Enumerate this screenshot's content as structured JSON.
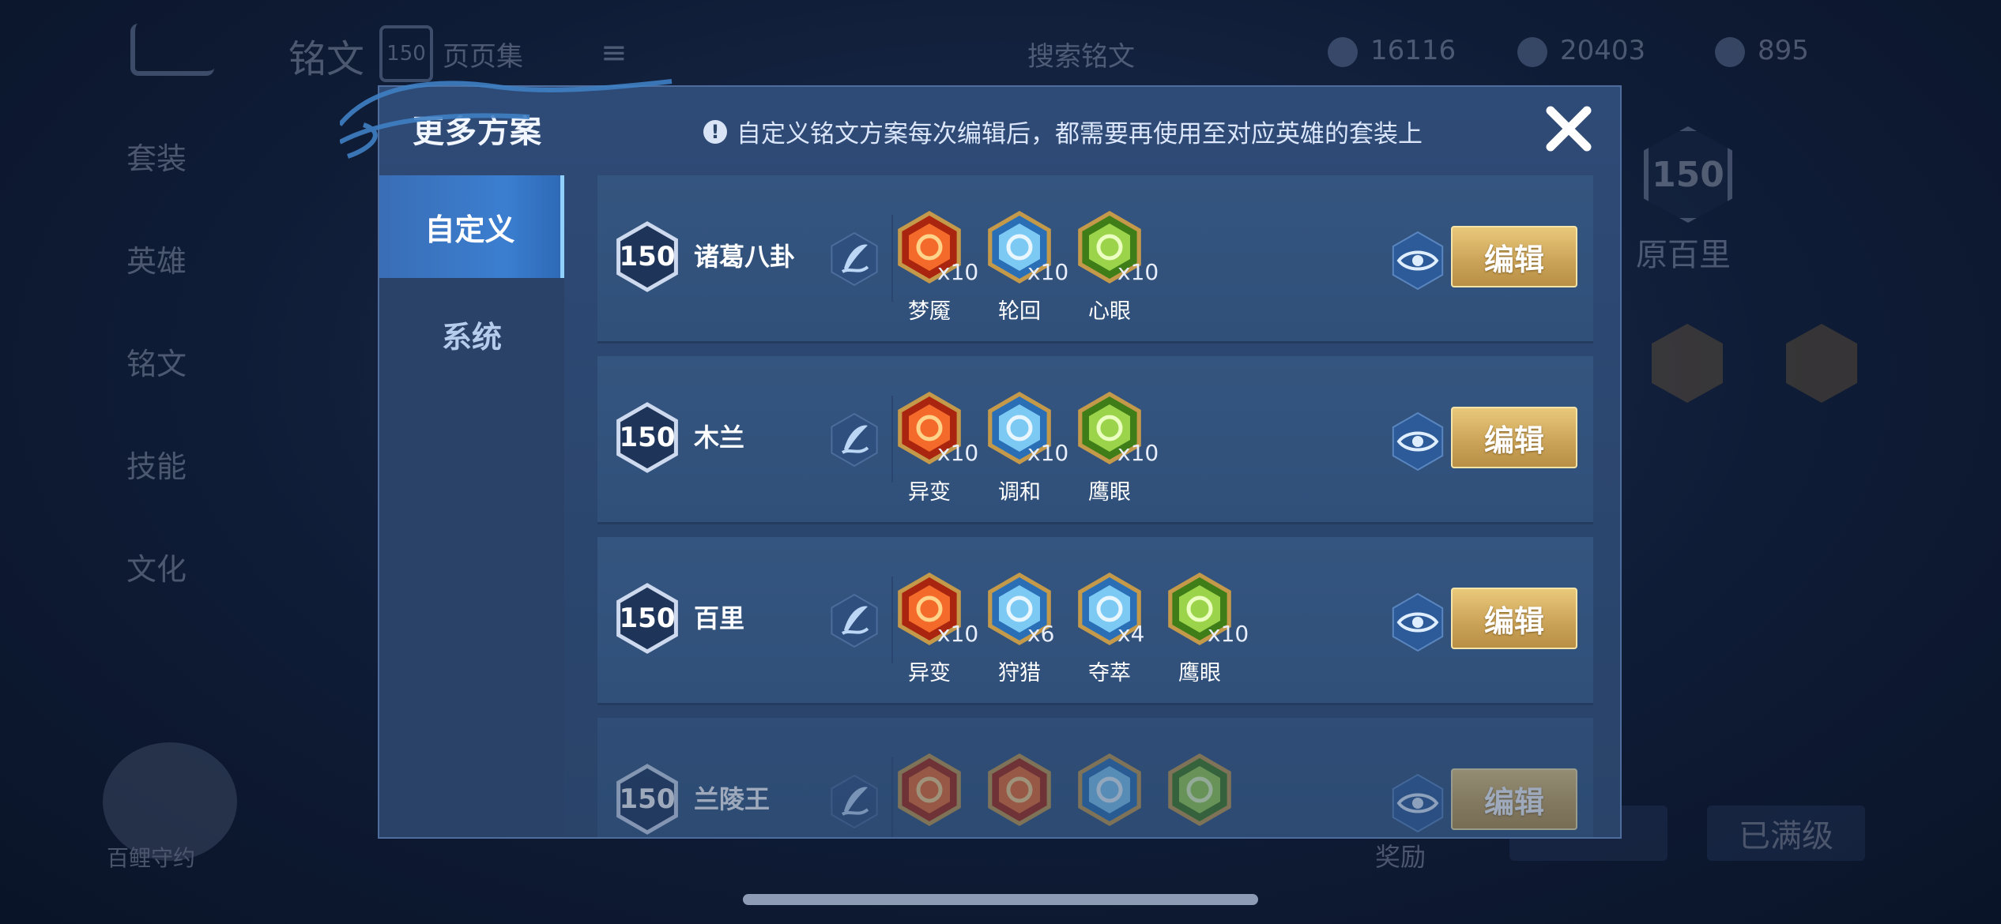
{
  "background": {
    "title": "铭文",
    "level": "150",
    "subtitle": "页页集",
    "menu_icon": "≡",
    "search_text": "搜索铭文",
    "currencies": [
      "16116",
      "20403",
      "895"
    ],
    "nav": [
      "套装",
      "英雄",
      "铭文",
      "技能",
      "文化"
    ],
    "hero_level": "150",
    "hero_name": "原百里",
    "avatar_label": "百鲤守约",
    "bottom_label": "奖励",
    "bottom_button": "已满级"
  },
  "modal": {
    "title": "更多方案",
    "notice": "自定义铭文方案每次编辑后，都需要再使用至对应英雄的套装上",
    "close_icon": "close-x-icon"
  },
  "tabs": [
    {
      "label": "自定义",
      "active": true
    },
    {
      "label": "系统",
      "active": false
    }
  ],
  "plans": [
    {
      "level": "150",
      "name": "诸葛八卦",
      "runes": [
        {
          "name": "梦魇",
          "count": "x10",
          "color": "red"
        },
        {
          "name": "轮回",
          "count": "x10",
          "color": "blue"
        },
        {
          "name": "心眼",
          "count": "x10",
          "color": "green"
        }
      ],
      "edit_label": "编辑"
    },
    {
      "level": "150",
      "name": "木兰",
      "runes": [
        {
          "name": "异变",
          "count": "x10",
          "color": "red"
        },
        {
          "name": "调和",
          "count": "x10",
          "color": "blue"
        },
        {
          "name": "鹰眼",
          "count": "x10",
          "color": "green"
        }
      ],
      "edit_label": "编辑"
    },
    {
      "level": "150",
      "name": "百里",
      "runes": [
        {
          "name": "异变",
          "count": "x10",
          "color": "red"
        },
        {
          "name": "狩猎",
          "count": "x6",
          "color": "blue"
        },
        {
          "name": "夺萃",
          "count": "x4",
          "color": "blue"
        },
        {
          "name": "鹰眼",
          "count": "x10",
          "color": "green"
        }
      ],
      "edit_label": "编辑"
    },
    {
      "level": "150",
      "name": "兰陵王",
      "runes": [
        {
          "name": "",
          "count": "",
          "color": "red"
        },
        {
          "name": "",
          "count": "",
          "color": "red"
        },
        {
          "name": "",
          "count": "",
          "color": "blue"
        },
        {
          "name": "",
          "count": "",
          "color": "green"
        }
      ],
      "edit_label": "编辑"
    }
  ],
  "colors": {
    "rune_red": "#d9501e",
    "rune_blue": "#4aa6e6",
    "rune_green": "#7bbd2e",
    "gold_frame": "#e2b55a",
    "edit_button": "#caa257"
  }
}
